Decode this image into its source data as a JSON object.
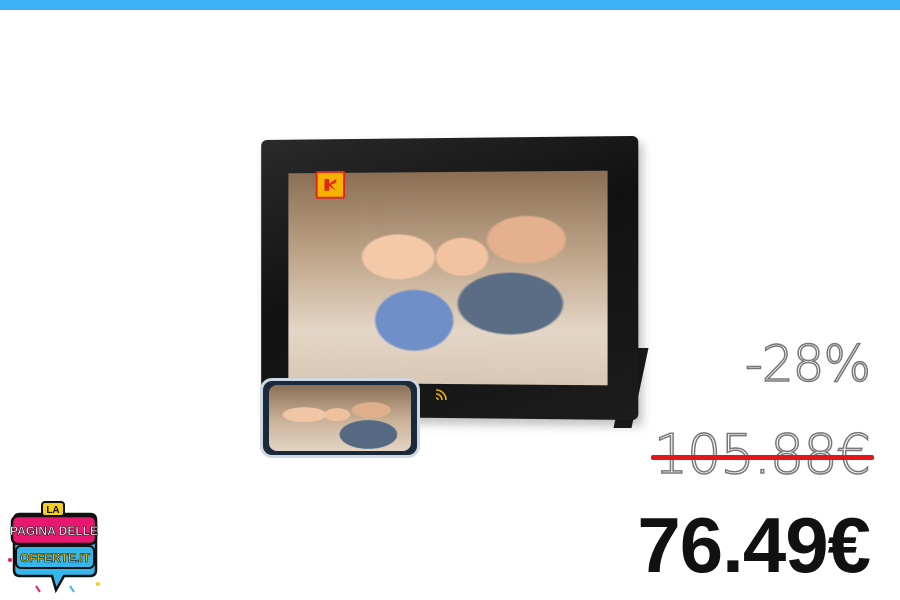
{
  "colors": {
    "top_bar": "#3db2f5",
    "strike": "#e4151b",
    "price": "#111111",
    "logo_pink": "#e8176f",
    "logo_blue": "#35b7ec",
    "logo_yellow": "#f5cf1a"
  },
  "product": {
    "brand_icon": "kodak-logo-icon",
    "wifi_icon": "wifi-icon"
  },
  "pricing": {
    "discount": "-28%",
    "old_price": "105.88€",
    "new_price": "76.49€"
  },
  "logo": {
    "line1": "LA",
    "line2": "PAGINA DELLE",
    "line3": "OFFERTE.IT"
  }
}
